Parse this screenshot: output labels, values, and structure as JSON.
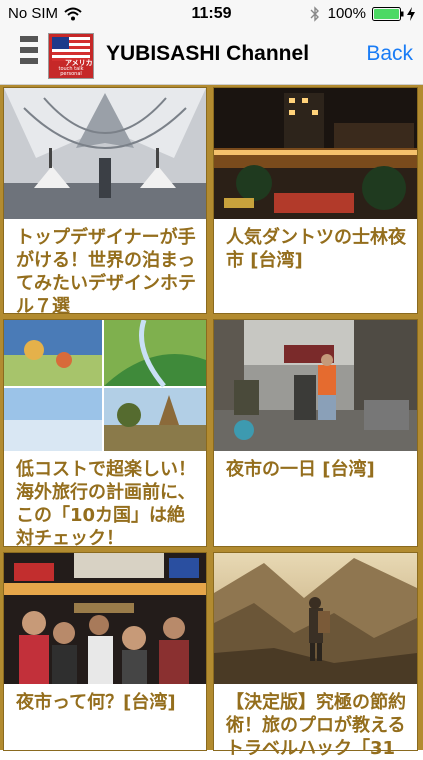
{
  "status_bar": {
    "carrier": "No SIM",
    "time": "11:59",
    "battery": "100%"
  },
  "nav": {
    "title": "YUBISASHI Channel",
    "back_label": "Back",
    "logo_text": "アメリカ",
    "logo_subtext": "touch talk personal"
  },
  "colors": {
    "accent_gold": "#b28b30",
    "title_text": "#946e1d",
    "link_blue": "#1a7cf5"
  },
  "articles": [
    {
      "title": "トップデザイナーが手がける！世界の泊まってみたいデザインホテル７選"
    },
    {
      "title": "人気ダントツの士林夜市 [台湾]"
    },
    {
      "title": "低コストで超楽しい！海外旅行の計画前に、この「10カ国」は絶対チェック！"
    },
    {
      "title": "夜市の一日 [台湾]"
    },
    {
      "title": "夜市って何？[台湾]"
    },
    {
      "title": "【決定版】究極の節約術！旅のプロが教えるトラベルハック「31"
    }
  ]
}
